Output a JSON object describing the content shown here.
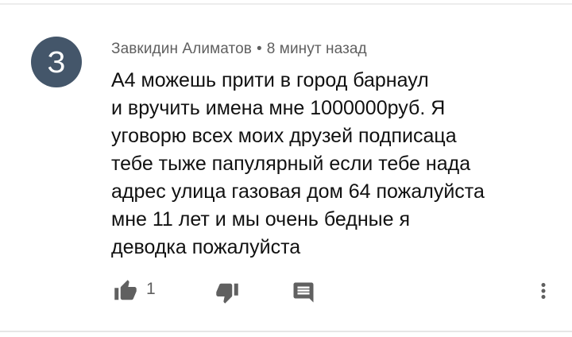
{
  "comment": {
    "avatar_letter": "З",
    "author": "Завкидин Алиматов",
    "separator": "•",
    "timestamp": "8 минут назад",
    "text": "А4 можешь прити в город барнаул\nи вручить имена мне 1000000руб. Я\nуговорю всех моих друзей подписаца\nтебе тыже папулярный если тебе нада\nадрес  улица газовая дом 64 пожалуйста\nмне 11 лет и мы очень бедные  я\nдеводка пожалуйста",
    "like_count": "1"
  },
  "icons": {
    "like": "thumbs-up-icon",
    "dislike": "thumbs-down-icon",
    "reply": "reply-comment-icon",
    "more": "more-vert-icon"
  },
  "colors": {
    "avatar_bg": "#44566a",
    "text": "#111111",
    "meta": "#606060",
    "icon": "#606060"
  }
}
